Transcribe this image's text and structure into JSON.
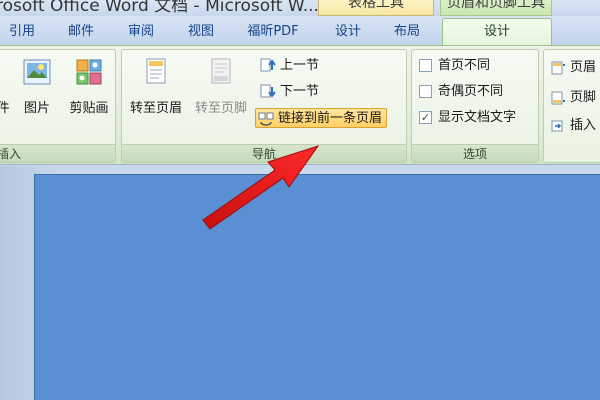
{
  "window": {
    "title": "rosoft Office Word 文档 - Microsoft W..."
  },
  "context_groups": {
    "table_tools": "表格工具",
    "header_footer_tools": "页眉和页脚工具"
  },
  "tabs": [
    {
      "label": "引用"
    },
    {
      "label": "邮件"
    },
    {
      "label": "审阅"
    },
    {
      "label": "视图"
    },
    {
      "label": "福昕PDF"
    },
    {
      "label": "设计"
    },
    {
      "label": "布局"
    },
    {
      "label": "设计",
      "active": true
    }
  ],
  "ribbon": {
    "insert_group": {
      "label": "插入",
      "buttons": [
        {
          "label": "件",
          "icon": "file-icon"
        },
        {
          "label": "图片",
          "icon": "picture-icon"
        },
        {
          "label": "剪贴画",
          "icon": "clipart-icon"
        }
      ]
    },
    "navigation_group": {
      "label": "导航",
      "go_to_header": {
        "label": "转至页眉",
        "icon": "header-page-icon"
      },
      "go_to_footer": {
        "label": "转至页脚",
        "icon": "footer-page-icon",
        "disabled": true
      },
      "previous_section": {
        "label": "上一节",
        "icon": "previous-section-icon"
      },
      "next_section": {
        "label": "下一节",
        "icon": "next-section-icon"
      },
      "link_to_previous": {
        "label": "链接到前一条页眉",
        "icon": "link-icon",
        "highlighted": true
      }
    },
    "options_group": {
      "label": "选项",
      "checkboxes": [
        {
          "label": "首页不同",
          "checked": false
        },
        {
          "label": "奇偶页不同",
          "checked": false
        },
        {
          "label": "显示文档文字",
          "checked": true
        }
      ]
    },
    "position_group": {
      "items": [
        {
          "label": "页眉",
          "icon": "header-position-icon"
        },
        {
          "label": "页脚",
          "icon": "footer-position-icon"
        },
        {
          "label": "插入",
          "icon": "insert-tab-icon"
        }
      ]
    }
  },
  "annotation": {
    "arrow_color": "#e31b1b",
    "icon": "red-arrow-icon"
  },
  "colors": {
    "page": "#5b8fd3",
    "active_tab": "#e6f4dc",
    "highlight": "#ffcf66"
  }
}
